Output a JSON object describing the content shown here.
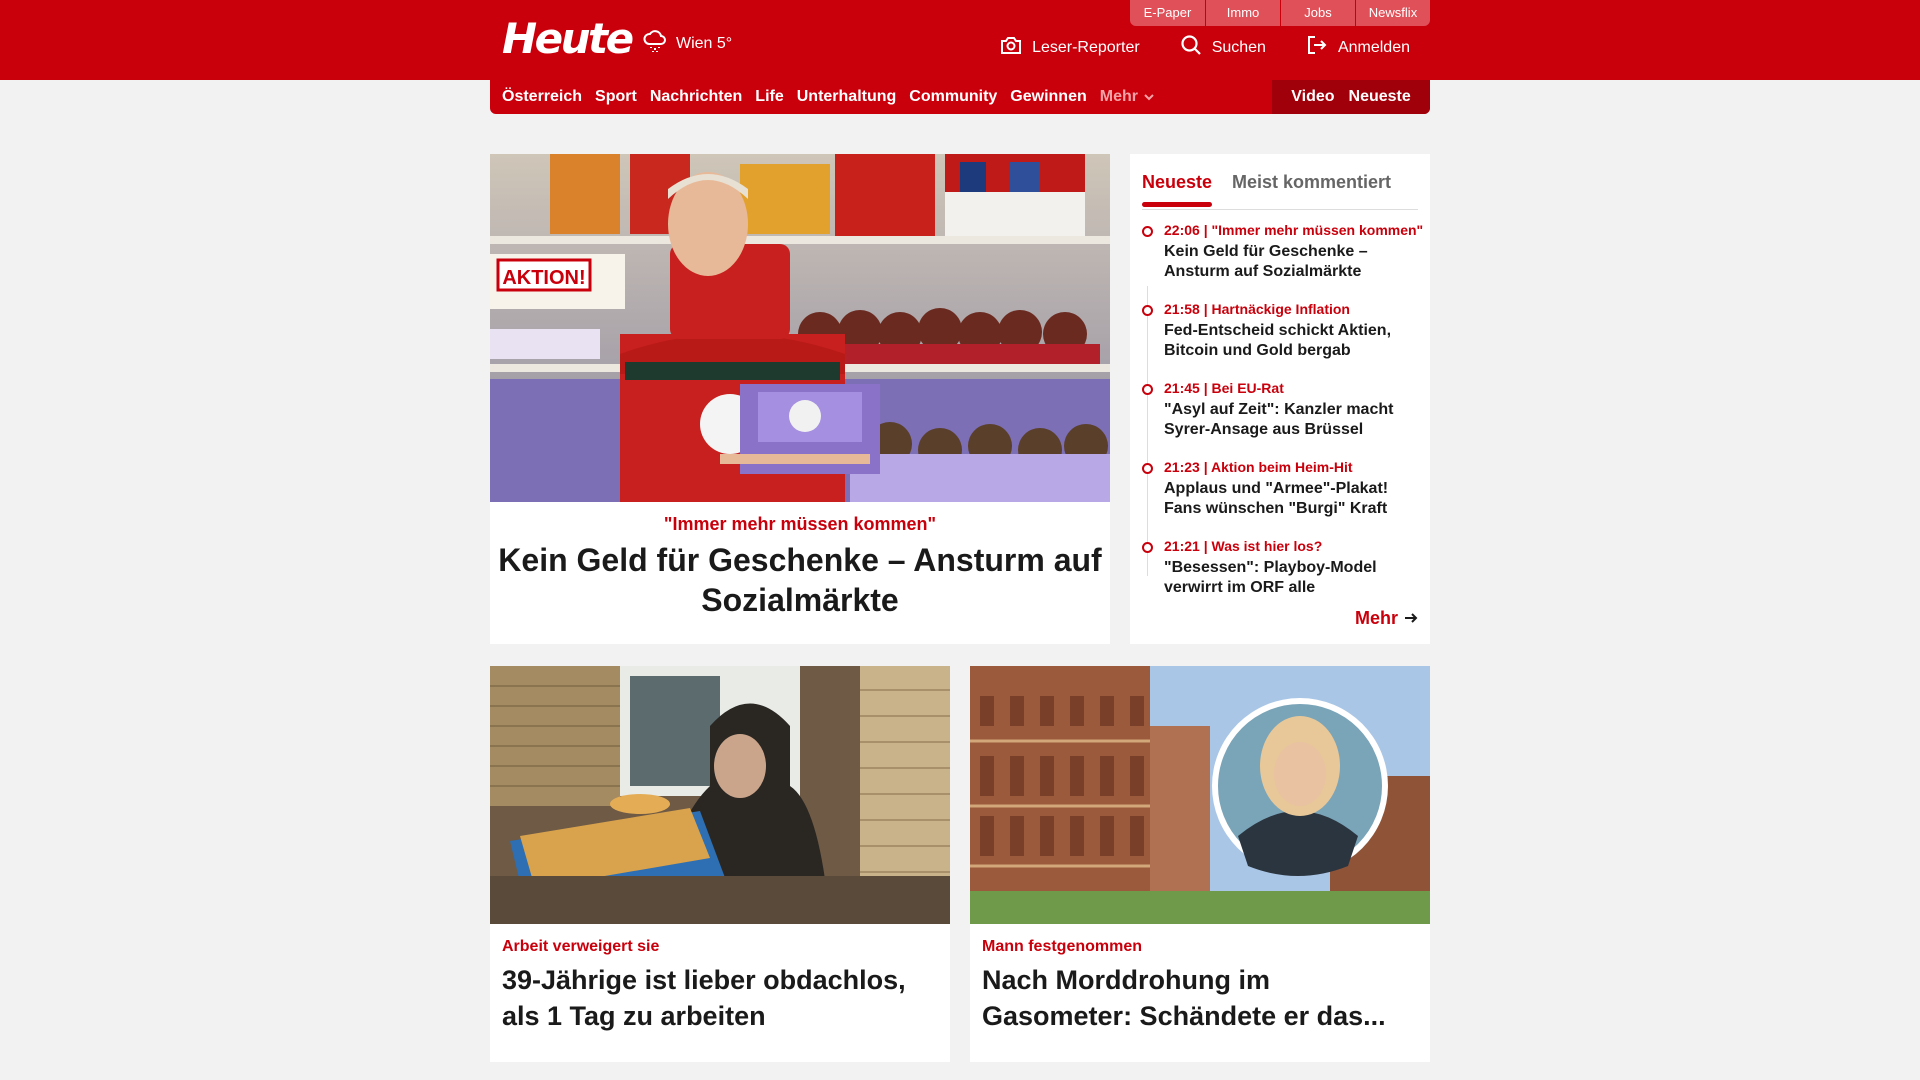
{
  "header": {
    "logo": "Heute",
    "weather": "Wien 5°",
    "top_links": [
      "E-Paper",
      "Immo",
      "Jobs",
      "Newsflix"
    ],
    "actions": {
      "leser_reporter": "Leser-Reporter",
      "suchen": "Suchen",
      "anmelden": "Anmelden"
    }
  },
  "nav": {
    "items": [
      "Österreich",
      "Sport",
      "Nachrichten",
      "Life",
      "Unterhaltung",
      "Community",
      "Gewinnen"
    ],
    "more": "Mehr",
    "video": "Video",
    "neueste": "Neueste"
  },
  "hero": {
    "kicker": "\"Immer mehr müssen kommen\"",
    "title": "Kein Geld für Geschenke – Ansturm auf Sozialmärkte",
    "sign_aktion": "AKTION!"
  },
  "sidebar": {
    "tabs": [
      "Neueste",
      "Meist kommentiert"
    ],
    "items": [
      {
        "time": "22:06",
        "kicker": "\"Immer mehr müssen kommen\"",
        "title": "Kein Geld für Geschenke – Ansturm auf Sozialmärkte"
      },
      {
        "time": "21:58",
        "kicker": "Hartnäckige Inflation",
        "title": "Fed-Entscheid schickt Aktien, Bitcoin und Gold bergab"
      },
      {
        "time": "21:45",
        "kicker": "Bei EU-Rat",
        "title": "\"Asyl auf Zeit\": Kanzler macht Syrer-Ansage aus Brüssel"
      },
      {
        "time": "21:23",
        "kicker": "Aktion beim Heim-Hit",
        "title": "Applaus und \"Armee\"-Plakat! Fans wünschen \"Burgi\" Kraft"
      },
      {
        "time": "21:21",
        "kicker": "Was ist hier los?",
        "title": "\"Besessen\": Playboy-Model verwirrt im ORF alle"
      }
    ],
    "more": "Mehr"
  },
  "cards": [
    {
      "kicker": "Arbeit verweigert sie",
      "title": "39-Jährige ist lieber obdachlos, als 1 Tag zu arbeiten"
    },
    {
      "kicker": "Mann festgenommen",
      "title": "Nach Morddrohung im Gasometer: Schändete er das..."
    }
  ],
  "colors": {
    "brand_red": "#c9000c",
    "background": "#f2f2f2"
  }
}
